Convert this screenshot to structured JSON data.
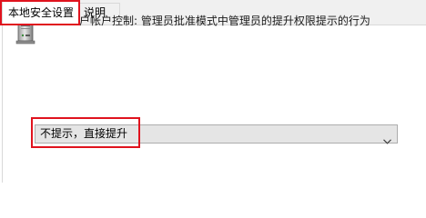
{
  "tabs": [
    {
      "label": "本地安全设置",
      "active": true
    },
    {
      "label": "说明",
      "active": false
    }
  ],
  "policy": {
    "icon": "server-policy-icon",
    "title": "用户帐户控制: 管理员批准模式中管理员的提升权限提示的行为"
  },
  "setting": {
    "selected_value": "不提示，直接提升"
  },
  "colors": {
    "highlight": "#e0131e",
    "tab_background": "#f0f0f0",
    "dropdown_background": "#e5e5e5"
  }
}
